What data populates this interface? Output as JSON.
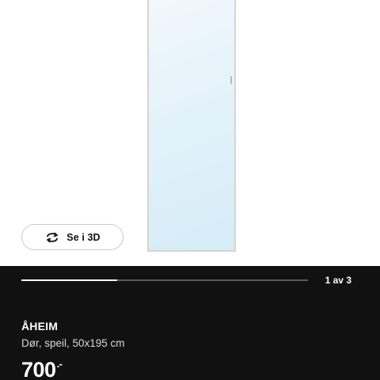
{
  "gallery": {
    "view3d_label": "Se i 3D",
    "progress": 0.333,
    "counter": "1 av 3"
  },
  "product": {
    "name": "ÅHEIM",
    "description": "Dør, speil, 50x195 cm",
    "price": "700",
    "price_suffix": ".-"
  },
  "colors": {
    "info_background": "#111111",
    "mirror_tint": "#e3f2fa"
  }
}
